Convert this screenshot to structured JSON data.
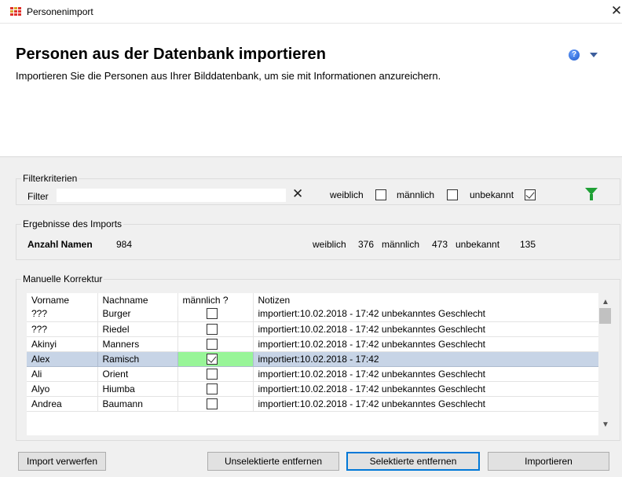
{
  "window": {
    "title": "Personenimport",
    "app_icon": "grid-dots-icon",
    "close_glyph": "✕"
  },
  "header": {
    "title": "Personen aus der Datenbank importieren",
    "subtitle": "Importieren Sie die Personen aus Ihrer Bilddatenbank, um sie mit Informationen anzureichern.",
    "help_glyph": "?",
    "help_icon": "help-circle-icon",
    "menu_icon": "chevron-down-icon"
  },
  "filter": {
    "legend": "Filterkriterien",
    "label": "Filter",
    "value": "",
    "clear_glyph": "✕",
    "weiblich_label": "weiblich",
    "weiblich_checked": false,
    "maennlich_label": "männlich",
    "maennlich_checked": false,
    "unbekannt_label": "unbekannt",
    "unbekannt_checked": true,
    "apply_icon": "funnel-icon",
    "accent_color": "#1fa035"
  },
  "results": {
    "legend": "Ergebnisse des Imports",
    "count_label": "Anzahl Namen",
    "count_value": "984",
    "weiblich_label": "weiblich",
    "weiblich_value": "376",
    "maennlich_label": "männlich",
    "maennlich_value": "473",
    "unbekannt_label": "unbekannt",
    "unbekannt_value": "135"
  },
  "manual": {
    "legend": "Manuelle Korrektur",
    "columns": [
      "Vorname",
      "Nachname",
      "männlich ?",
      "Notizen"
    ],
    "rows": [
      {
        "vorname": "???",
        "nachname": "Burger",
        "maennlich": false,
        "notiz": "importiert:10.02.2018 - 17:42 unbekanntes Geschlecht",
        "selected": false
      },
      {
        "vorname": "???",
        "nachname": "Riedel",
        "maennlich": false,
        "notiz": "importiert:10.02.2018 - 17:42 unbekanntes Geschlecht",
        "selected": false
      },
      {
        "vorname": "Akinyi",
        "nachname": "Manners",
        "maennlich": false,
        "notiz": "importiert:10.02.2018 - 17:42 unbekanntes Geschlecht",
        "selected": false
      },
      {
        "vorname": "Alex",
        "nachname": "Ramisch",
        "maennlich": true,
        "notiz": "importiert:10.02.2018 - 17:42",
        "selected": true
      },
      {
        "vorname": "Ali",
        "nachname": "Orient",
        "maennlich": false,
        "notiz": "importiert:10.02.2018 - 17:42 unbekanntes Geschlecht",
        "selected": false
      },
      {
        "vorname": "Alyo",
        "nachname": "Hiumba",
        "maennlich": false,
        "notiz": "importiert:10.02.2018 - 17:42 unbekanntes Geschlecht",
        "selected": false
      },
      {
        "vorname": "Andrea",
        "nachname": "Baumann",
        "maennlich": false,
        "notiz": "importiert:10.02.2018 - 17:42 unbekanntes Geschlecht",
        "selected": false
      }
    ],
    "selected_row_color": "#c7d4e6",
    "checked_cell_color": "#98f598"
  },
  "buttons": {
    "discard": "Import verwerfen",
    "remove_unselected": "Unselektierte entfernen",
    "remove_selected": "Selektierte entfernen",
    "import": "Importieren"
  }
}
